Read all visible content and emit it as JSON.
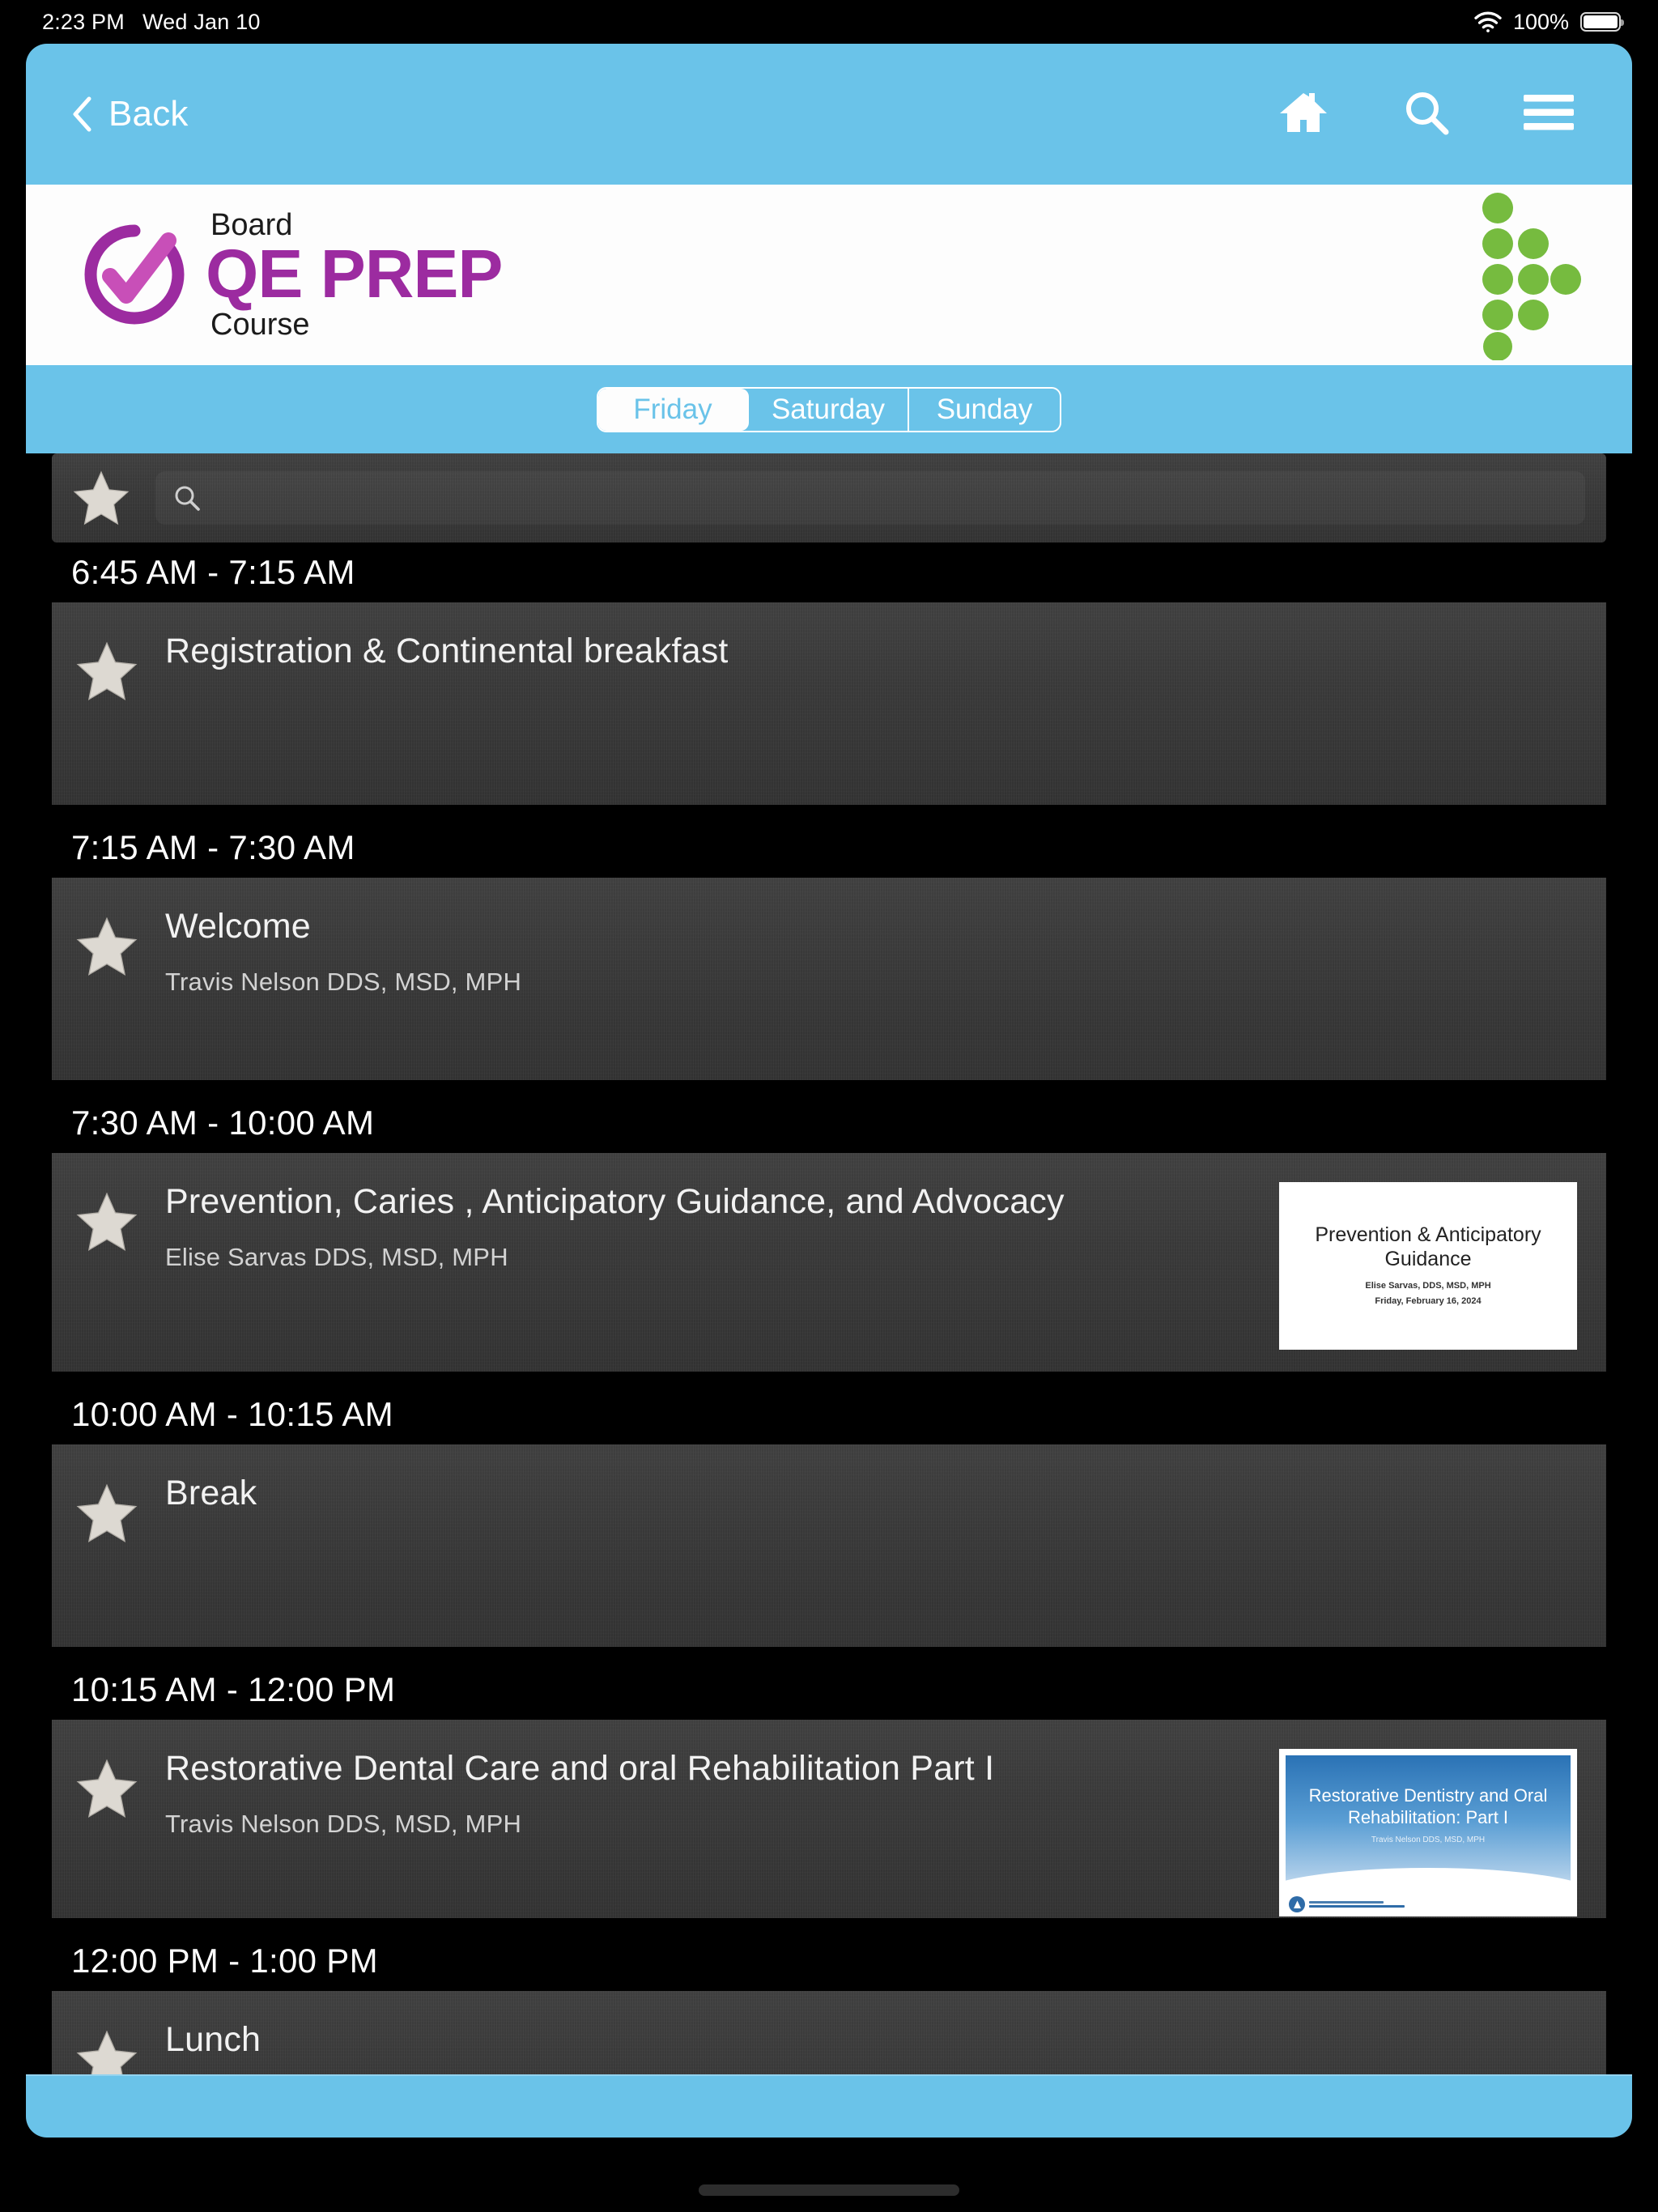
{
  "status_bar": {
    "time": "2:23 PM",
    "date": "Wed Jan 10",
    "battery_percent": "100%",
    "wifi_icon": "wifi-icon",
    "battery_icon": "battery-full-icon"
  },
  "navbar": {
    "back_label": "Back",
    "back_icon": "chevron-left-icon",
    "home_icon": "home-icon",
    "search_icon": "search-icon",
    "menu_icon": "hamburger-menu-icon",
    "background_color": "#6ac3e9"
  },
  "brand": {
    "line_top": "Board",
    "line_main": "QE PREP",
    "line_bottom": "Course",
    "mark_icon": "check-circle-logo-icon",
    "brand_color": "#9c2ba0",
    "partner_logo_icon": "green-dots-arrow-logo",
    "partner_logo_color": "#76bb3f"
  },
  "day_tabs": {
    "items": [
      {
        "label": "Friday",
        "active": true
      },
      {
        "label": "Saturday",
        "active": false
      },
      {
        "label": "Sunday",
        "active": false
      }
    ]
  },
  "toolbar": {
    "favorites_icon": "star-icon",
    "search_icon": "search-icon",
    "search_value": "",
    "search_placeholder": ""
  },
  "schedule": {
    "blocks": [
      {
        "time": "6:45 AM - 7:15 AM",
        "title": "Registration & Continental breakfast",
        "speaker": "",
        "star_icon": "star-icon",
        "thumb": null
      },
      {
        "time": "7:15 AM - 7:30 AM",
        "title": "Welcome",
        "speaker": "Travis Nelson DDS, MSD, MPH",
        "star_icon": "star-icon",
        "thumb": null
      },
      {
        "time": "7:30 AM - 10:00 AM",
        "title": "Prevention, Caries , Anticipatory Guidance, and Advocacy",
        "speaker": "Elise Sarvas DDS, MSD, MPH",
        "star_icon": "star-icon",
        "thumb": {
          "style": "plain",
          "title": "Prevention & Anticipatory Guidance",
          "sub_line_1": "Elise Sarvas, DDS, MSD, MPH",
          "sub_line_2": "Friday, February 16, 2024"
        }
      },
      {
        "time": "10:00 AM - 10:15 AM",
        "title": "Break",
        "speaker": "",
        "star_icon": "star-icon",
        "thumb": null
      },
      {
        "time": "10:15 AM - 12:00 PM",
        "title": "Restorative Dental Care and oral Rehabilitation Part I",
        "speaker": "Travis Nelson DDS, MSD, MPH",
        "star_icon": "star-icon",
        "thumb": {
          "style": "blue",
          "title": "Restorative Dentistry and Oral Rehabilitation: Part I",
          "sub_line_1": "Travis Nelson DDS, MSD, MPH",
          "sub_line_2": ""
        }
      },
      {
        "time": "12:00 PM - 1:00 PM",
        "title": "Lunch",
        "speaker": "",
        "star_icon": "star-icon",
        "thumb": null
      }
    ]
  }
}
